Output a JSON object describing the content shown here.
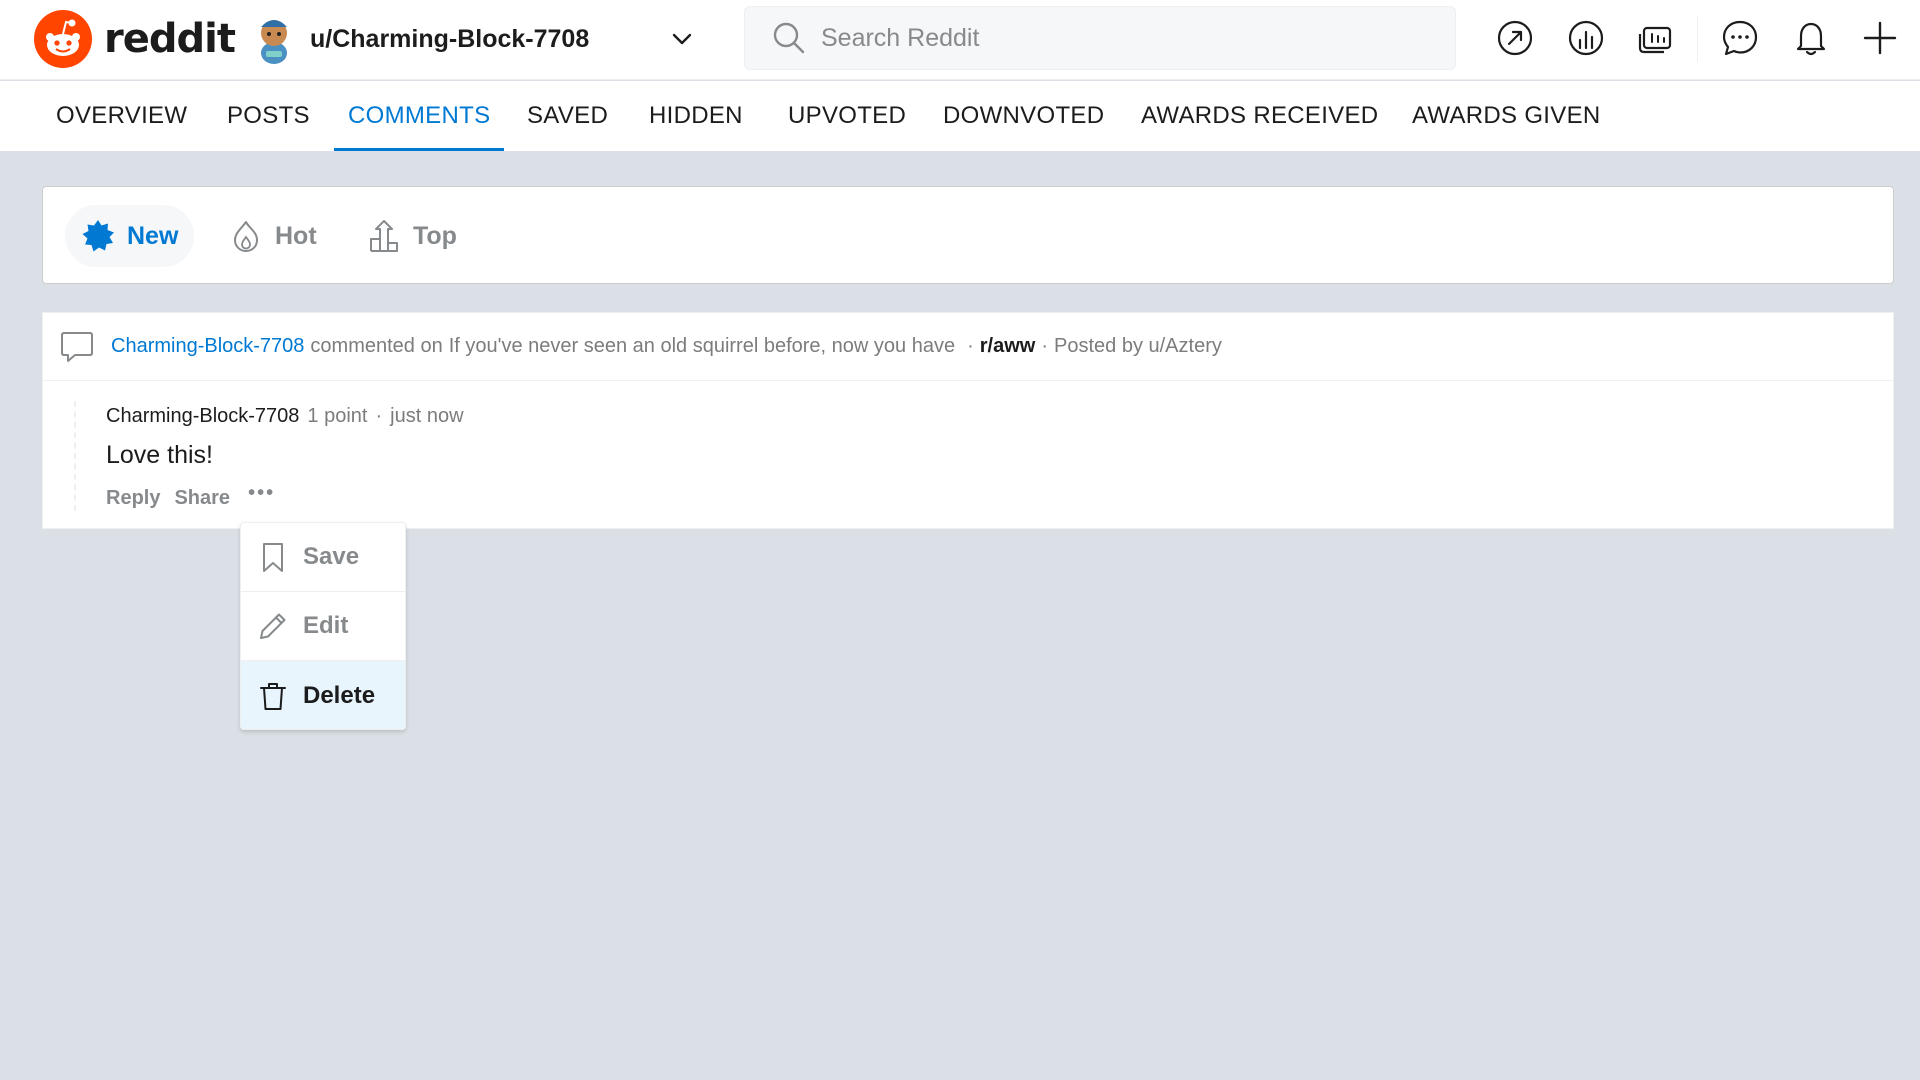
{
  "brand": {
    "name": "reddit",
    "color": "#ff4500"
  },
  "user_menu": {
    "username": "u/Charming-Block-7708"
  },
  "search": {
    "placeholder": "Search Reddit"
  },
  "header_icons": [
    "popular-icon",
    "stats-icon",
    "chat-tv-icon",
    "chat-icon",
    "notifications-icon",
    "create-post-icon"
  ],
  "tabs": [
    {
      "label": "OVERVIEW",
      "active": false
    },
    {
      "label": "POSTS",
      "active": false
    },
    {
      "label": "COMMENTS",
      "active": true
    },
    {
      "label": "SAVED",
      "active": false
    },
    {
      "label": "HIDDEN",
      "active": false
    },
    {
      "label": "UPVOTED",
      "active": false
    },
    {
      "label": "DOWNVOTED",
      "active": false
    },
    {
      "label": "AWARDS RECEIVED",
      "active": false
    },
    {
      "label": "AWARDS GIVEN",
      "active": false
    }
  ],
  "sort": [
    {
      "label": "New",
      "active": true
    },
    {
      "label": "Hot",
      "active": false
    },
    {
      "label": "Top",
      "active": false
    }
  ],
  "comment_card": {
    "author": "Charming-Block-7708",
    "action_text": "commented on",
    "post_title": "If you've never seen an old squirrel before, now you have",
    "subreddit": "r/aww",
    "posted_by": "Posted by u/Aztery",
    "comment": {
      "author": "Charming-Block-7708",
      "points": "1 point",
      "time": "just now",
      "body": "Love this!",
      "reply_label": "Reply",
      "share_label": "Share",
      "more_label": "•••"
    }
  },
  "menu": {
    "items": [
      {
        "label": "Save",
        "icon": "bookmark-icon"
      },
      {
        "label": "Edit",
        "icon": "pencil-icon"
      },
      {
        "label": "Delete",
        "icon": "trash-icon"
      }
    ]
  },
  "colors": {
    "accent": "#0079d3",
    "background": "#dae0e6",
    "muted": "#878a8c"
  }
}
